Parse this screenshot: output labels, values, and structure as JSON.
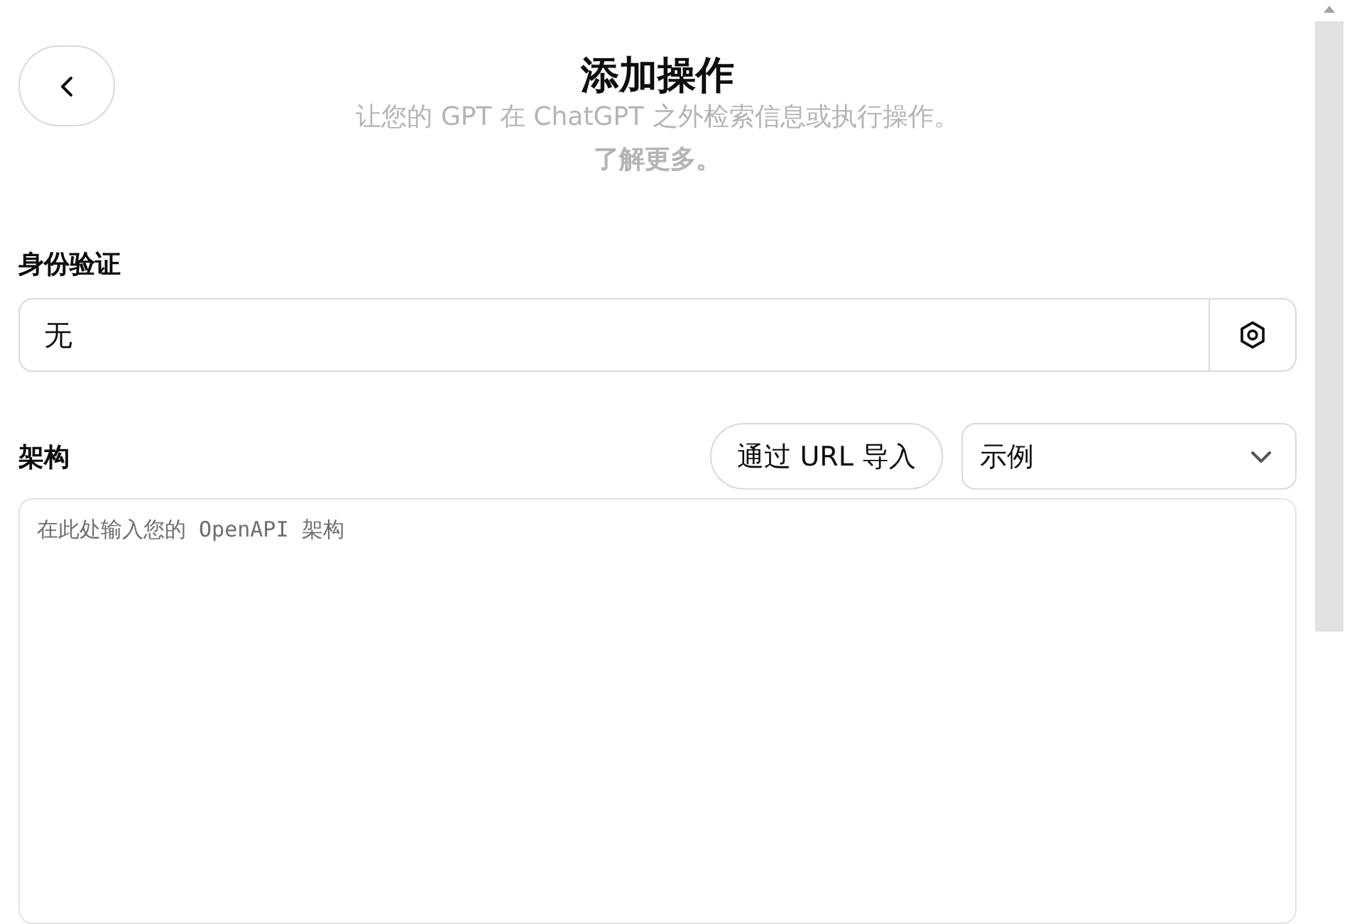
{
  "header": {
    "title": "添加操作",
    "subtitle": "让您的 GPT 在 ChatGPT 之外检索信息或执行操作。",
    "learn_more": "了解更多。"
  },
  "authentication": {
    "label": "身份验证",
    "value": "无"
  },
  "schema": {
    "label": "架构",
    "import_button": "通过 URL 导入",
    "example_select": "示例",
    "placeholder": "在此处输入您的 OpenAPI 架构"
  }
}
